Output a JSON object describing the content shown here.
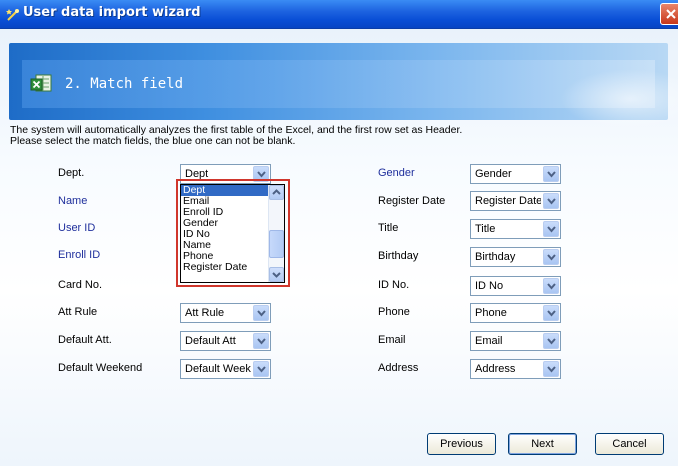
{
  "window": {
    "title": "User data import wizard"
  },
  "header": {
    "step_title": "2. Match field"
  },
  "description": {
    "line1": "The system will automatically analyzes the first table of the Excel, and the first row set as Header.",
    "line2": "Please select the match fields, the blue one can not be blank."
  },
  "left_fields": [
    {
      "label": "Dept.",
      "value": "Dept",
      "required": false
    },
    {
      "label": "Name",
      "value": "",
      "required": true
    },
    {
      "label": "User ID",
      "value": "",
      "required": true
    },
    {
      "label": "Enroll ID",
      "value": "",
      "required": true
    },
    {
      "label": "Card No.",
      "value": "",
      "required": false
    },
    {
      "label": "Att Rule",
      "value": "Att Rule",
      "required": false
    },
    {
      "label": "Default Att.",
      "value": "Default Att",
      "required": false
    },
    {
      "label": "Default Weekend",
      "value": "Default Weeker",
      "required": false
    }
  ],
  "right_fields": [
    {
      "label": "Gender",
      "value": "Gender",
      "required": true
    },
    {
      "label": "Register Date",
      "value": "Register Date",
      "required": false
    },
    {
      "label": "Title",
      "value": "Title",
      "required": false
    },
    {
      "label": "Birthday",
      "value": "Birthday",
      "required": false
    },
    {
      "label": "ID No.",
      "value": "ID No",
      "required": false
    },
    {
      "label": "Phone",
      "value": "Phone",
      "required": false
    },
    {
      "label": "Email",
      "value": "Email",
      "required": false
    },
    {
      "label": "Address",
      "value": "Address",
      "required": false
    }
  ],
  "dropdown": {
    "options": [
      "Dept",
      "Email",
      "Enroll ID",
      "Gender",
      "ID No",
      "Name",
      "Phone",
      "Register Date"
    ],
    "selected": "Dept"
  },
  "buttons": {
    "previous": "Previous",
    "next": "Next",
    "cancel": "Cancel"
  },
  "colors": {
    "required_label": "#1f2f9c",
    "title_bar": "#0a4fd6",
    "highlight_border": "#d0362c",
    "selection": "#316ac5"
  }
}
